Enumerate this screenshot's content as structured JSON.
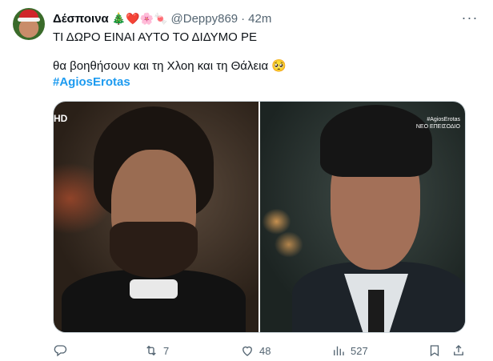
{
  "tweet": {
    "author_name": "Δέσποινα",
    "author_emojis": "🎄❤️🌸🍬",
    "handle": "@Deppy869",
    "separator": "·",
    "time": "42m",
    "more_label": "···",
    "text_line1": "ΤΙ ΔΩΡΟ ΕΙΝΑΙ ΑΥΤΟ ΤΟ ΔΙΔΥΜΟ ΡΕ",
    "text_line2": "θα βοηθήσουν και τη Χλοη και τη Θάλεια 🥺",
    "hashtag": "#AgiosErotas"
  },
  "media": {
    "left_badge": "HD",
    "watermark_line1": "#AgiosErotas",
    "watermark_line2": "ΝΕΟ ΕΠΕΙΣΟΔΙΟ"
  },
  "actions": {
    "reply_count": "",
    "retweet_count": "7",
    "like_count": "48",
    "view_count": "527"
  },
  "icons": [
    "reply-icon",
    "retweet-icon",
    "like-icon",
    "views-icon",
    "bookmark-icon",
    "share-icon",
    "more-icon"
  ],
  "colors": {
    "link": "#1d9bf0",
    "secondary_text": "#536471",
    "primary_text": "#0f1419"
  }
}
